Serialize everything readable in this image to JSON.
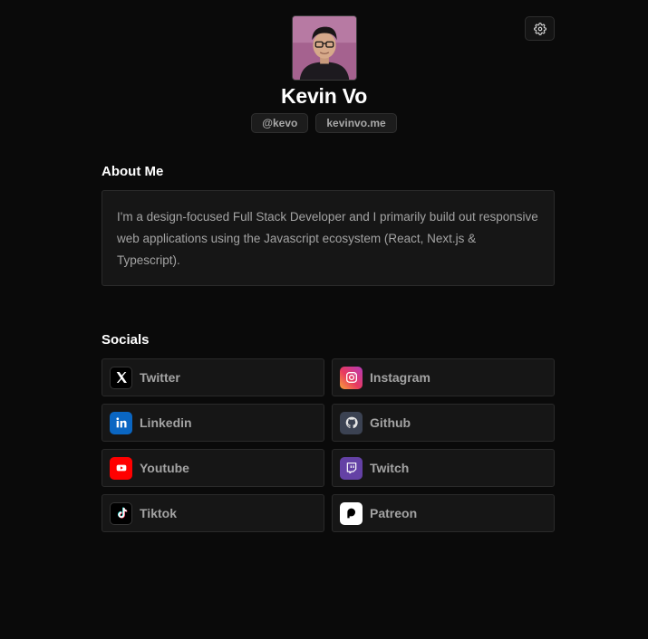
{
  "profile": {
    "name": "Kevin Vo",
    "tags": [
      "@kevo",
      "kevinvo.me"
    ]
  },
  "about": {
    "title": "About Me",
    "text": "I'm a design-focused Full Stack Developer and I primarily build out responsive web applications using the Javascript ecosystem (React, Next.js & Typescript)."
  },
  "socials": {
    "title": "Socials",
    "items": [
      {
        "label": "Twitter",
        "icon": "x-icon",
        "color": "#000000"
      },
      {
        "label": "Instagram",
        "icon": "instagram-icon",
        "color": "#e1306c"
      },
      {
        "label": "Linkedin",
        "icon": "linkedin-icon",
        "color": "#0a66c2"
      },
      {
        "label": "Github",
        "icon": "github-icon",
        "color": "#3b4252"
      },
      {
        "label": "Youtube",
        "icon": "youtube-icon",
        "color": "#ff0000"
      },
      {
        "label": "Twitch",
        "icon": "twitch-icon",
        "color": "#6441a5"
      },
      {
        "label": "Tiktok",
        "icon": "tiktok-icon",
        "color": "#000000"
      },
      {
        "label": "Patreon",
        "icon": "patreon-icon",
        "color": "#ffffff"
      }
    ]
  },
  "settings": {
    "icon": "gear-icon"
  }
}
